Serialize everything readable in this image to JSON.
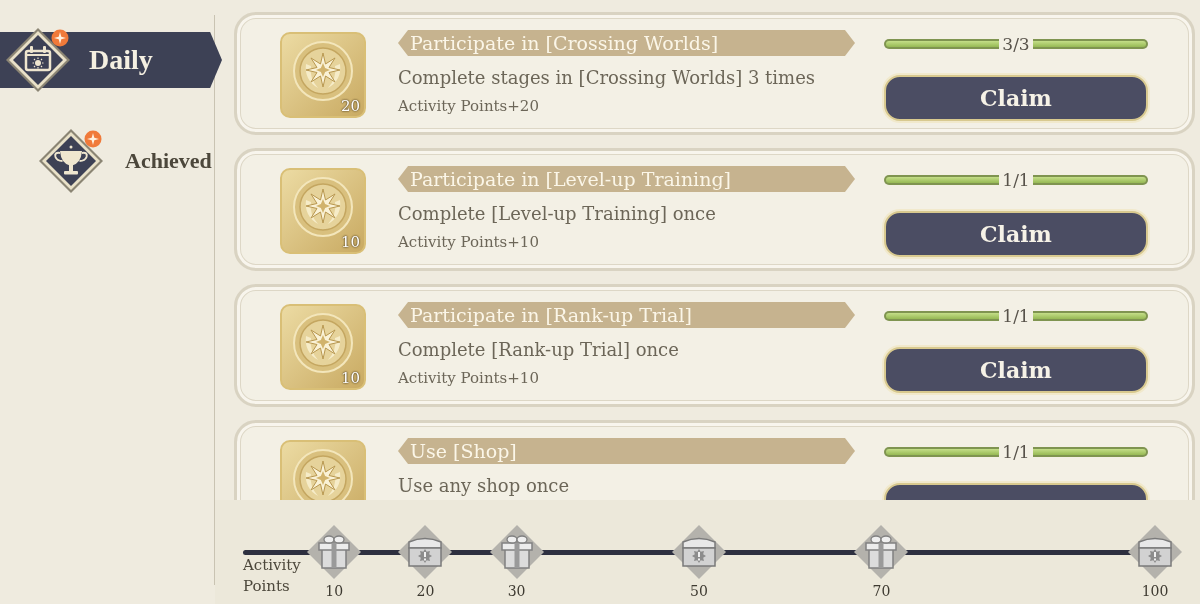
{
  "sidebar": {
    "tabs": [
      {
        "label": "Daily",
        "selected": true,
        "badge": true
      },
      {
        "label": "Achieved",
        "selected": false,
        "badge": true
      }
    ]
  },
  "tasks": [
    {
      "title": "Participate in [Crossing Worlds]",
      "description": "Complete stages in [Crossing Worlds] 3 times",
      "points": "Activity Points+20",
      "reward_count": "20",
      "progress": "3/3",
      "level": 1,
      "button": "Claim"
    },
    {
      "title": "Participate in [Level-up Training]",
      "description": "Complete [Level-up Training] once",
      "points": "Activity Points+10",
      "reward_count": "10",
      "progress": "1/1",
      "level": 1,
      "button": "Claim"
    },
    {
      "title": "Participate in [Rank-up Trial]",
      "description": "Complete [Rank-up Trial] once",
      "points": "Activity Points+10",
      "reward_count": "10",
      "progress": "1/1",
      "level": 1,
      "button": "Claim"
    },
    {
      "title": "Use [Shop]",
      "description": "Use any shop once",
      "progress": "1/1",
      "level": 1
    }
  ],
  "activity_bar": {
    "label": "Activity Points",
    "milestones": [
      {
        "kind": "gift",
        "value": "10"
      },
      {
        "kind": "chest",
        "value": "20"
      },
      {
        "kind": "gift",
        "value": "30"
      },
      {
        "kind": "chest",
        "value": "50"
      },
      {
        "kind": "gift",
        "value": "70"
      },
      {
        "kind": "chest",
        "value": "100"
      }
    ]
  }
}
